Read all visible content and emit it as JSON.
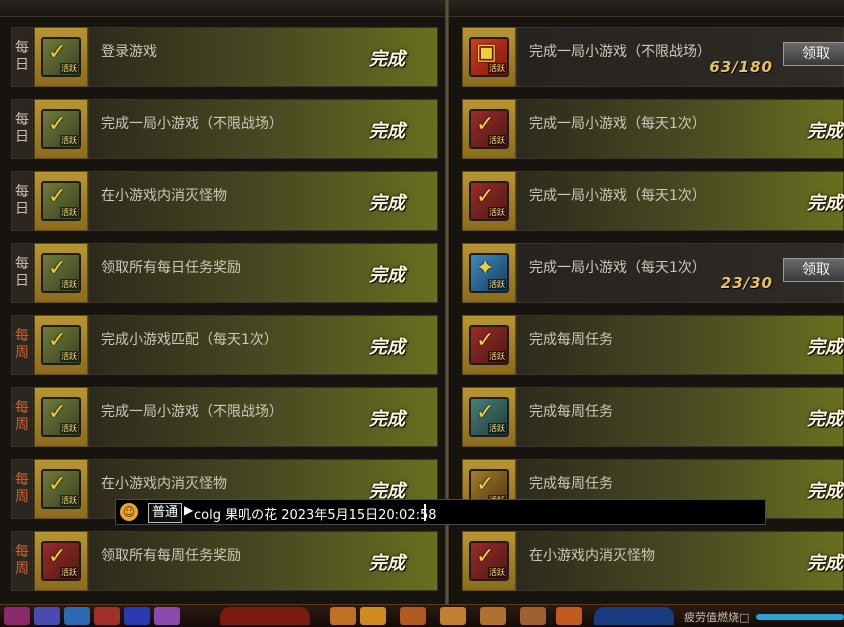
{
  "left_column": [
    {
      "period": [
        "每",
        "日"
      ],
      "period_type": "daily",
      "icon": "checkmark-scroll-icon",
      "icon_color": "olive",
      "title": "登录游戏",
      "status": "完成"
    },
    {
      "period": [
        "每",
        "日"
      ],
      "period_type": "daily",
      "icon": "checkmark-scroll-icon",
      "icon_color": "olive",
      "title": "完成一局小游戏（不限战场）",
      "status": "完成"
    },
    {
      "period": [
        "每",
        "日"
      ],
      "period_type": "daily",
      "icon": "checkmark-scroll-icon",
      "icon_color": "olive",
      "title": "在小游戏内消灭怪物",
      "status": "完成"
    },
    {
      "period": [
        "每",
        "日"
      ],
      "period_type": "daily",
      "icon": "checkmark-scroll-icon",
      "icon_color": "olive",
      "title": "领取所有每日任务奖励",
      "status": "完成"
    },
    {
      "period": [
        "每",
        "周"
      ],
      "period_type": "weekly",
      "icon": "checkmark-scroll-icon",
      "icon_color": "olive",
      "title": "完成小游戏匹配（每天1次）",
      "status": "完成"
    },
    {
      "period": [
        "每",
        "周"
      ],
      "period_type": "weekly",
      "icon": "checkmark-scroll-icon",
      "icon_color": "olive",
      "title": "完成一局小游戏（不限战场）",
      "status": "完成"
    },
    {
      "period": [
        "每",
        "周"
      ],
      "period_type": "weekly",
      "icon": "checkmark-scroll-icon",
      "icon_color": "olive",
      "title": "在小游戏内消灭怪物",
      "status": "完成"
    },
    {
      "period": [
        "每",
        "周"
      ],
      "period_type": "weekly",
      "icon": "checkmark-scroll-icon",
      "icon_color": "red",
      "title": "领取所有每周任务奖励",
      "status": "完成"
    }
  ],
  "right_column": [
    {
      "icon": "gift-box-icon",
      "icon_color": "gift",
      "title": "完成一局小游戏（不限战场）",
      "progress": "63/180",
      "button": "领取"
    },
    {
      "icon": "checkmark-scroll-icon",
      "icon_color": "red",
      "title": "完成一局小游戏（每天1次）",
      "status": "完成"
    },
    {
      "icon": "checkmark-scroll-icon",
      "icon_color": "red",
      "title": "完成一局小游戏（每天1次）",
      "status": "完成"
    },
    {
      "icon": "lightning-scroll-icon",
      "icon_color": "blue",
      "title": "完成一局小游戏（每天1次）",
      "progress": "23/30",
      "button": "领取"
    },
    {
      "icon": "checkmark-scroll-icon",
      "icon_color": "red",
      "title": "完成每周任务",
      "status": "完成"
    },
    {
      "icon": "checkmark-scroll-icon",
      "icon_color": "teal",
      "title": "完成每周任务",
      "status": "完成"
    },
    {
      "icon": "checkmark-scroll-icon",
      "icon_color": "gold",
      "title": "完成每周任务",
      "status": "完成"
    },
    {
      "icon": "checkmark-scroll-icon",
      "icon_color": "red",
      "title": "在小游戏内消灭怪物",
      "status": "完成"
    }
  ],
  "icon_badge": "活跃",
  "chat": {
    "channel": "普通",
    "message": "colg 果叽の花 2023年5月15日20:02:58"
  },
  "skillbar": {
    "status_text": "疲劳值燃烧□"
  },
  "colors": {
    "done_panel_accent": "#67701f",
    "weekly_tag": "#d2652c",
    "daily_tag": "#c9c2b6",
    "progress_text": "#e8c35a",
    "frame_gold": "#b89532"
  }
}
